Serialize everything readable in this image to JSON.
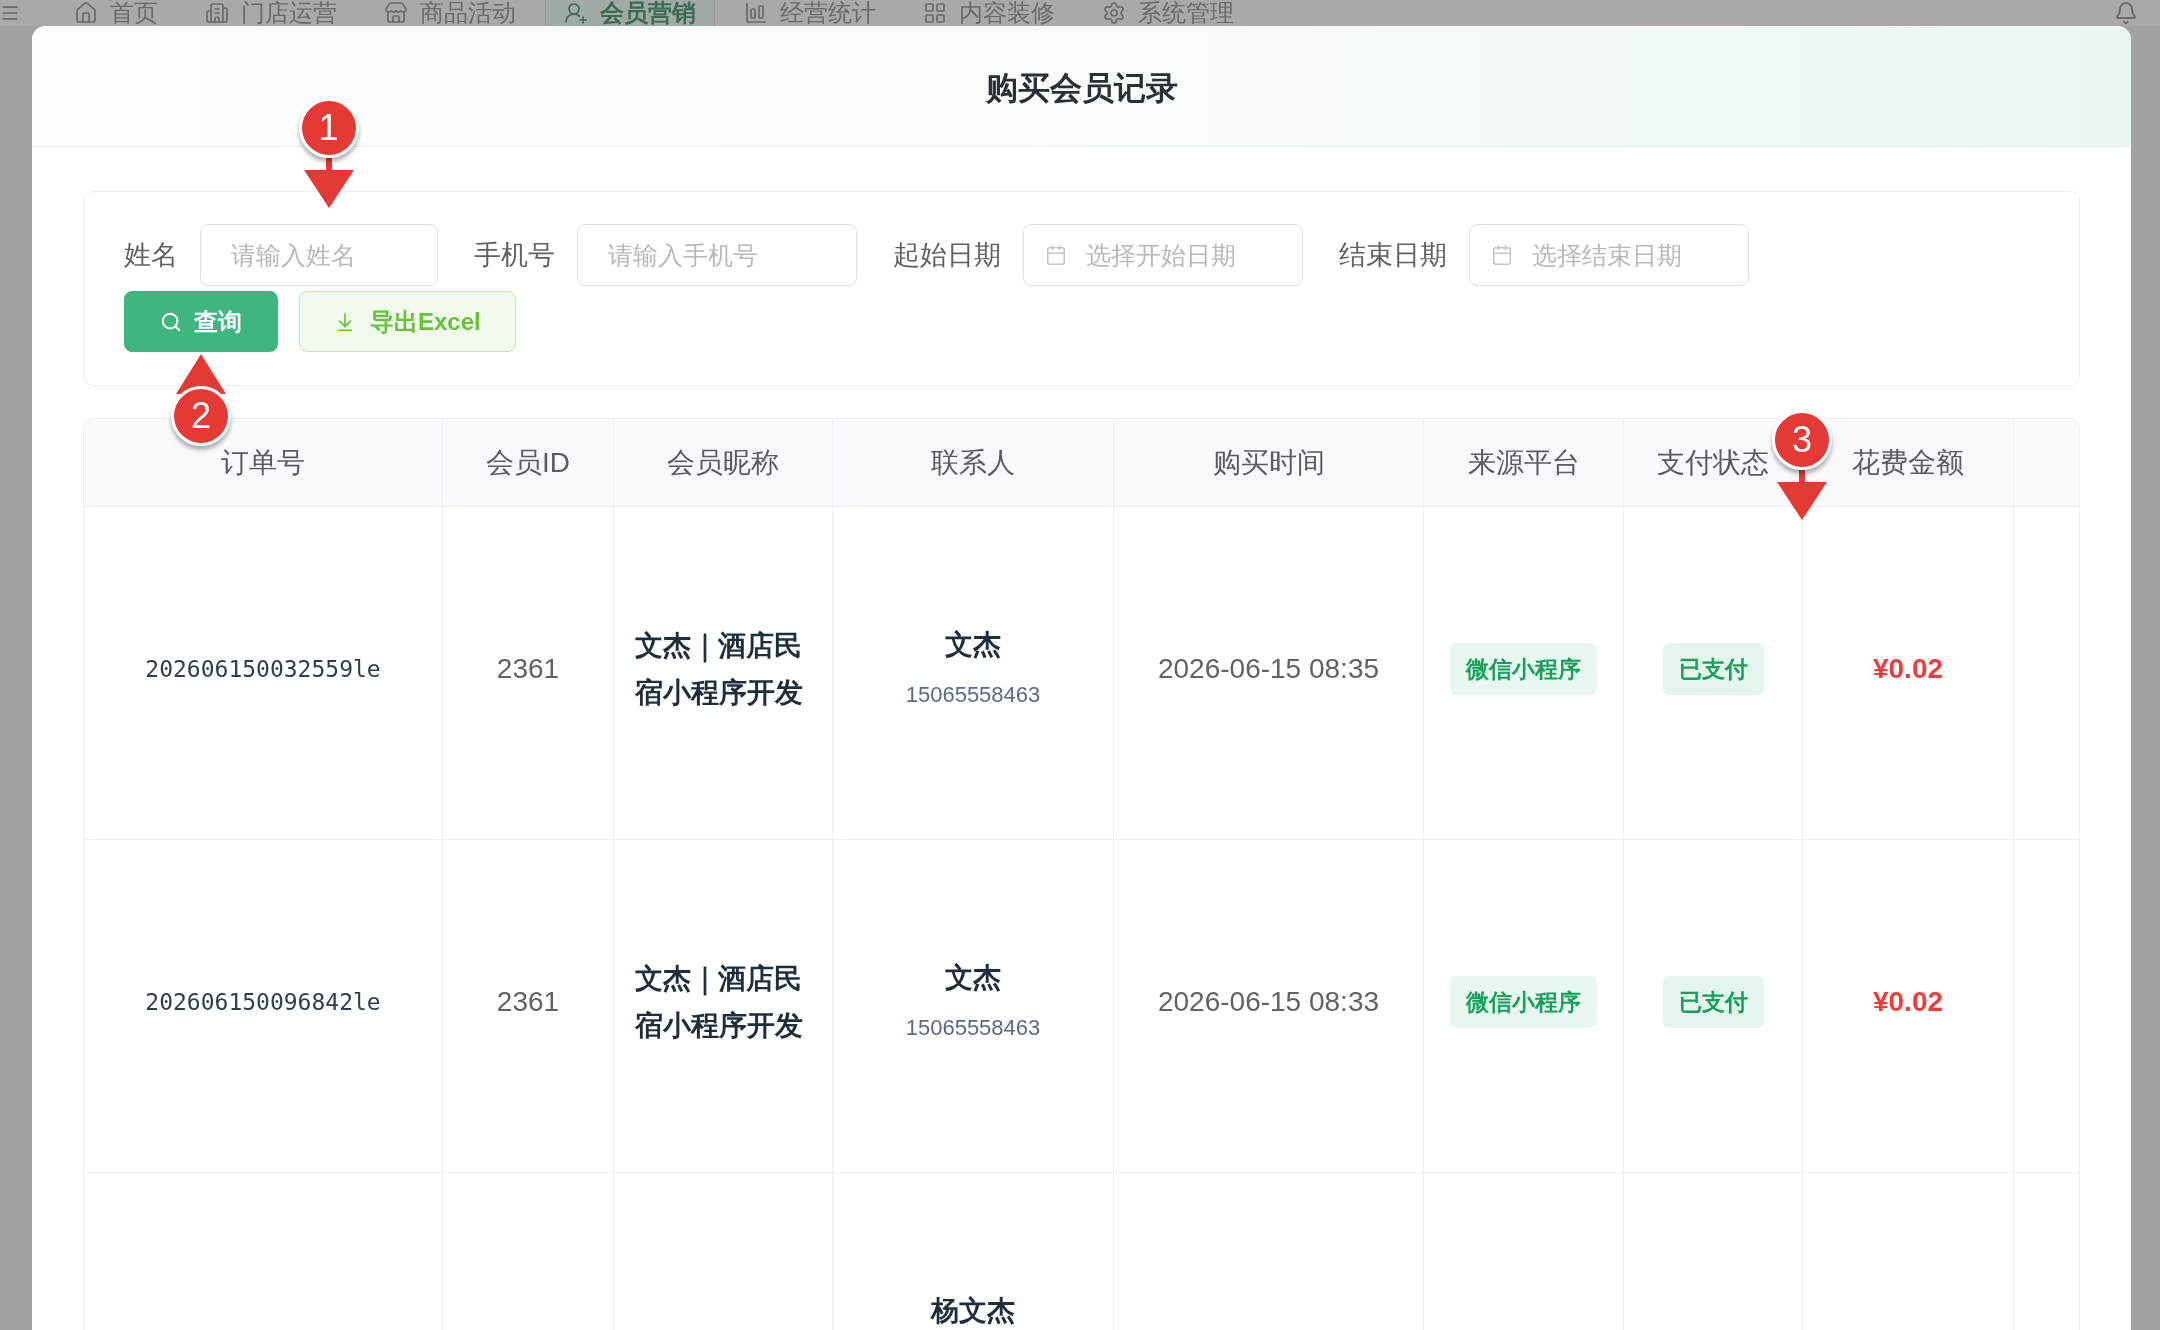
{
  "nav": {
    "items": [
      {
        "label": "首页",
        "selected": false
      },
      {
        "label": "门店运营",
        "selected": false
      },
      {
        "label": "商品活动",
        "selected": false
      },
      {
        "label": "会员营销",
        "selected": true
      },
      {
        "label": "经营统计",
        "selected": false
      },
      {
        "label": "内容装修",
        "selected": false
      },
      {
        "label": "系统管理",
        "selected": false
      }
    ]
  },
  "dialog": {
    "title": "购买会员记录"
  },
  "filters": [
    {
      "kind": "text",
      "label": "姓名",
      "placeholder": "请输入姓名",
      "callout": {
        "number": "1",
        "points_up": false
      }
    },
    {
      "kind": "text",
      "label": "手机号",
      "placeholder": "请输入手机号"
    },
    {
      "kind": "date",
      "label": "起始日期",
      "placeholder": "选择开始日期"
    },
    {
      "kind": "date",
      "label": "结束日期",
      "placeholder": "选择结束日期"
    }
  ],
  "buttons": [
    {
      "kind": "primary",
      "label": "查询",
      "callout": {
        "number": "2",
        "points_up": true
      }
    },
    {
      "kind": "export",
      "label": "导出Excel"
    }
  ],
  "table": {
    "columns": [
      {
        "label": "订单号"
      },
      {
        "label": "会员ID"
      },
      {
        "label": "会员昵称"
      },
      {
        "label": "联系人"
      },
      {
        "label": "购买时间"
      },
      {
        "label": "来源平台"
      },
      {
        "label": "支付状态",
        "callout": {
          "number": "3",
          "points_up": false
        }
      },
      {
        "label": "花费金额"
      }
    ],
    "rows": [
      {
        "order_no": "202606150032559le",
        "member_id": "2361",
        "nickname": "文杰｜酒店民宿小程序开发",
        "contact_name": "文杰",
        "contact_phone": "15065558463",
        "purchase_time": "2026-06-15 08:35",
        "source": "微信小程序",
        "pay_status": "已支付",
        "amount": "¥0.02"
      },
      {
        "order_no": "202606150096842le",
        "member_id": "2361",
        "nickname": "文杰｜酒店民宿小程序开发",
        "contact_name": "文杰",
        "contact_phone": "15065558463",
        "purchase_time": "2026-06-15 08:33",
        "source": "微信小程序",
        "pay_status": "已支付",
        "amount": "¥0.02"
      },
      {
        "contact_name": "杨文杰"
      }
    ]
  }
}
